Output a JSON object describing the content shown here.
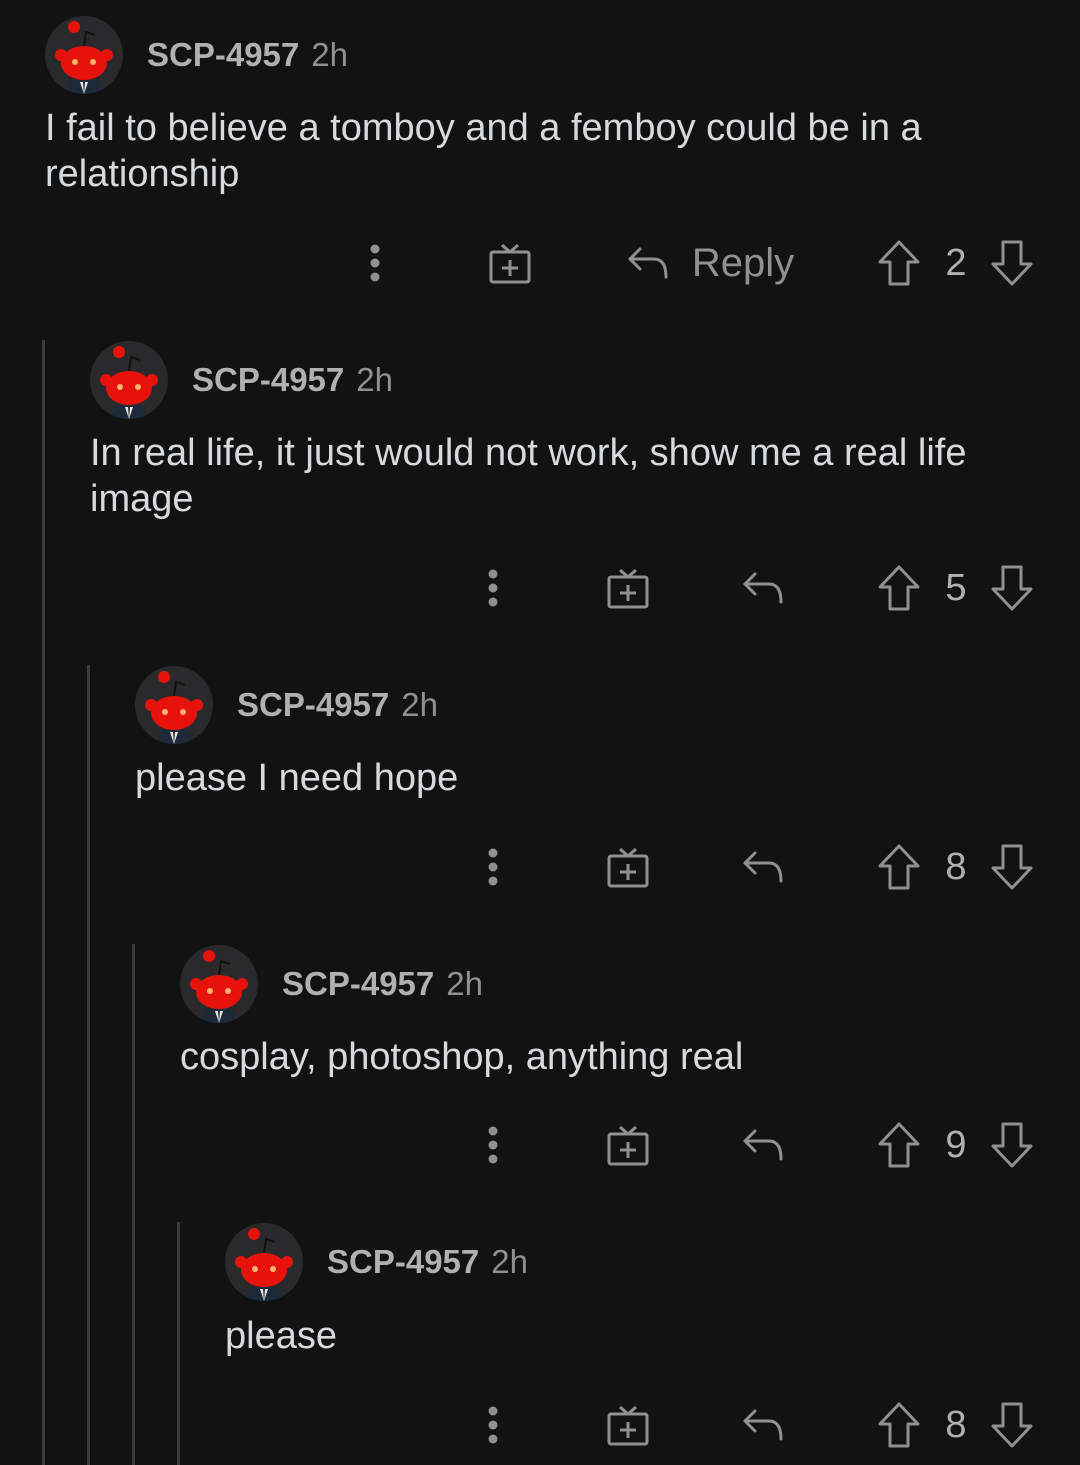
{
  "comments": [
    {
      "username": "SCP-4957",
      "time": "2h",
      "body": "I fail to believe a tomboy and a femboy could be in a\nrelationship",
      "reply_label": "Reply",
      "votes": "2"
    },
    {
      "username": "SCP-4957",
      "time": "2h",
      "body": "In real life, it just would not work, show me a real life\nimage",
      "votes": "5"
    },
    {
      "username": "SCP-4957",
      "time": "2h",
      "body": "please I need hope",
      "votes": "8"
    },
    {
      "username": "SCP-4957",
      "time": "2h",
      "body": "cosplay, photoshop, anything real",
      "votes": "9"
    },
    {
      "username": "SCP-4957",
      "time": "2h",
      "body": "please",
      "votes": "8"
    }
  ],
  "icons": {
    "avatar": "snoo-avatar-icon",
    "more": "more-options-icon",
    "award": "give-award-icon",
    "reply": "reply-arrow-icon",
    "upvote": "upvote-arrow-icon",
    "downvote": "downvote-arrow-icon"
  },
  "colors": {
    "background": "#121213",
    "text": "#d7dadc",
    "muted": "#8e9092",
    "thread_line": "#3a3a3c",
    "snoo_red": "#e8120c"
  }
}
